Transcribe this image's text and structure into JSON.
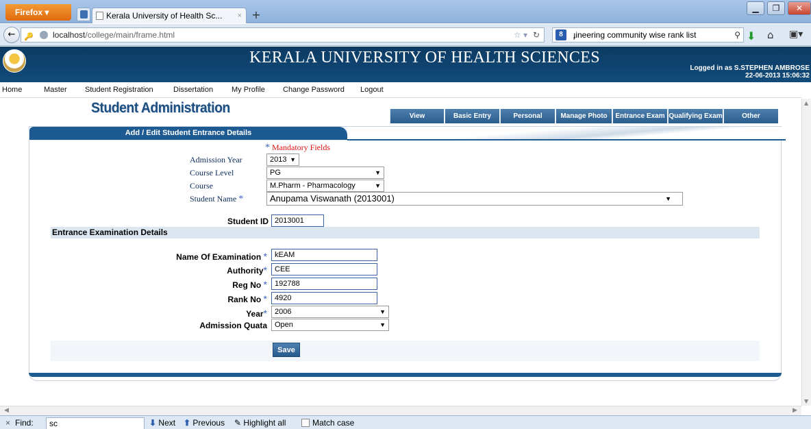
{
  "browser": {
    "menu_button": "Firefox",
    "tab_title": "Kerala University of Health Sc...",
    "tab_close": "×",
    "new_tab": "+",
    "url_host": "localhost",
    "url_path": "/college/main/frame.html",
    "search_text": "ɟineering community wise rank list",
    "search_engine": "8"
  },
  "site": {
    "title": "KERALA UNIVERSITY OF HEALTH SCIENCES",
    "logged_in": "Logged in as S.STEPHEN AMBROSE",
    "datetime": "22-06-2013 15:06:32"
  },
  "menu": [
    "Home",
    "Master",
    "Student Registration",
    "Dissertation",
    "My Profile",
    "Change Password",
    "Logout"
  ],
  "page": {
    "heading": "Student Administration",
    "tabs": [
      "View",
      "Basic Entry",
      "Personal",
      "Manage Photo",
      "Entrance Exam",
      "Qualifying Exam",
      "Other"
    ],
    "panel_title": "Add / Edit Student Entrance Details",
    "mandatory_note": "Mandatory Fields",
    "required_mark": "*"
  },
  "form": {
    "admission_year_label": "Admission Year",
    "admission_year": "2013",
    "course_level_label": "Course Level",
    "course_level": "PG",
    "course_label": "Course",
    "course": "M.Pharm - Pharmacology",
    "student_name_label": "Student Name",
    "student_name": "Anupama Viswanath (2013001)",
    "student_id_label": "Student ID",
    "student_id": "2013001"
  },
  "exam": {
    "section_title": "Entrance Examination Details",
    "name_label": "Name Of Examination",
    "name": "kEAM",
    "authority_label": "Authority",
    "authority": "CEE",
    "reg_no_label": "Reg No",
    "reg_no": "192788",
    "rank_no_label": "Rank No",
    "rank_no": "4920",
    "year_label": "Year",
    "year": "2006",
    "quota_label": "Admission Quata",
    "quota": "Open",
    "save": "Save"
  },
  "findbar": {
    "close": "×",
    "label": "Find:",
    "value": "sc",
    "next": "Next",
    "previous": "Previous",
    "highlight": "Highlight all",
    "match_case": "Match case"
  }
}
